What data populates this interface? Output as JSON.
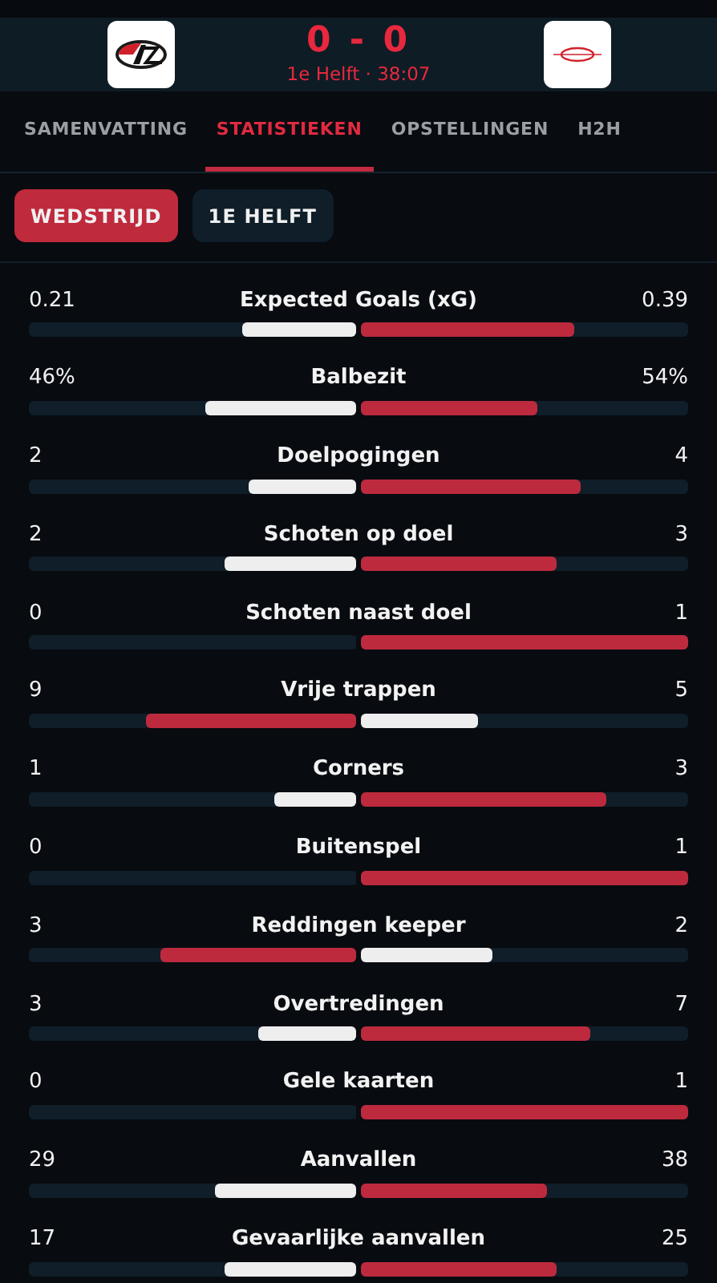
{
  "match": {
    "score": "0 - 0",
    "status": "1e Helft · 38:07"
  },
  "tabs": [
    {
      "label": "SAMENVATTING",
      "selected": false
    },
    {
      "label": "STATISTIEKEN",
      "selected": true
    },
    {
      "label": "OPSTELLINGEN",
      "selected": false
    },
    {
      "label": "H2H",
      "selected": false
    }
  ],
  "periods": [
    {
      "label": "WEDSTRIJD",
      "selected": true
    },
    {
      "label": "1E HELFT",
      "selected": false
    }
  ],
  "stats": [
    {
      "name": "Expected Goals (xG)",
      "home": {
        "value": "0.21",
        "level": 0.35
      },
      "away": {
        "value": "0.39",
        "level": 0.65
      }
    },
    {
      "name": "Balbezit",
      "home": {
        "value": "46%",
        "level": 0.46
      },
      "away": {
        "value": "54%",
        "level": 0.54
      }
    },
    {
      "name": "Doelpogingen",
      "home": {
        "value": "2",
        "level": 0.33
      },
      "away": {
        "value": "4",
        "level": 0.67
      }
    },
    {
      "name": "Schoten op doel",
      "home": {
        "value": "2",
        "level": 0.4
      },
      "away": {
        "value": "3",
        "level": 0.6
      }
    },
    {
      "name": "Schoten naast doel",
      "home": {
        "value": "0",
        "level": 0
      },
      "away": {
        "value": "1",
        "level": 1
      }
    },
    {
      "name": "Vrije trappen",
      "home": {
        "value": "9",
        "level": 0.64
      },
      "away": {
        "value": "5",
        "level": 0.36
      }
    },
    {
      "name": "Corners",
      "home": {
        "value": "1",
        "level": 0.25
      },
      "away": {
        "value": "3",
        "level": 0.75
      }
    },
    {
      "name": "Buitenspel",
      "home": {
        "value": "0",
        "level": 0
      },
      "away": {
        "value": "1",
        "level": 1
      }
    },
    {
      "name": "Reddingen keeper",
      "home": {
        "value": "3",
        "level": 0.6
      },
      "away": {
        "value": "2",
        "level": 0.4
      }
    },
    {
      "name": "Overtredingen",
      "home": {
        "value": "3",
        "level": 0.3
      },
      "away": {
        "value": "7",
        "level": 0.7
      }
    },
    {
      "name": "Gele kaarten",
      "home": {
        "value": "0",
        "level": 0
      },
      "away": {
        "value": "1",
        "level": 1
      }
    },
    {
      "name": "Aanvallen",
      "home": {
        "value": "29",
        "level": 0.43
      },
      "away": {
        "value": "38",
        "level": 0.57
      }
    },
    {
      "name": "Gevaarlijke aanvallen",
      "home": {
        "value": "17",
        "level": 0.4
      },
      "away": {
        "value": "25",
        "level": 0.6
      }
    }
  ]
}
